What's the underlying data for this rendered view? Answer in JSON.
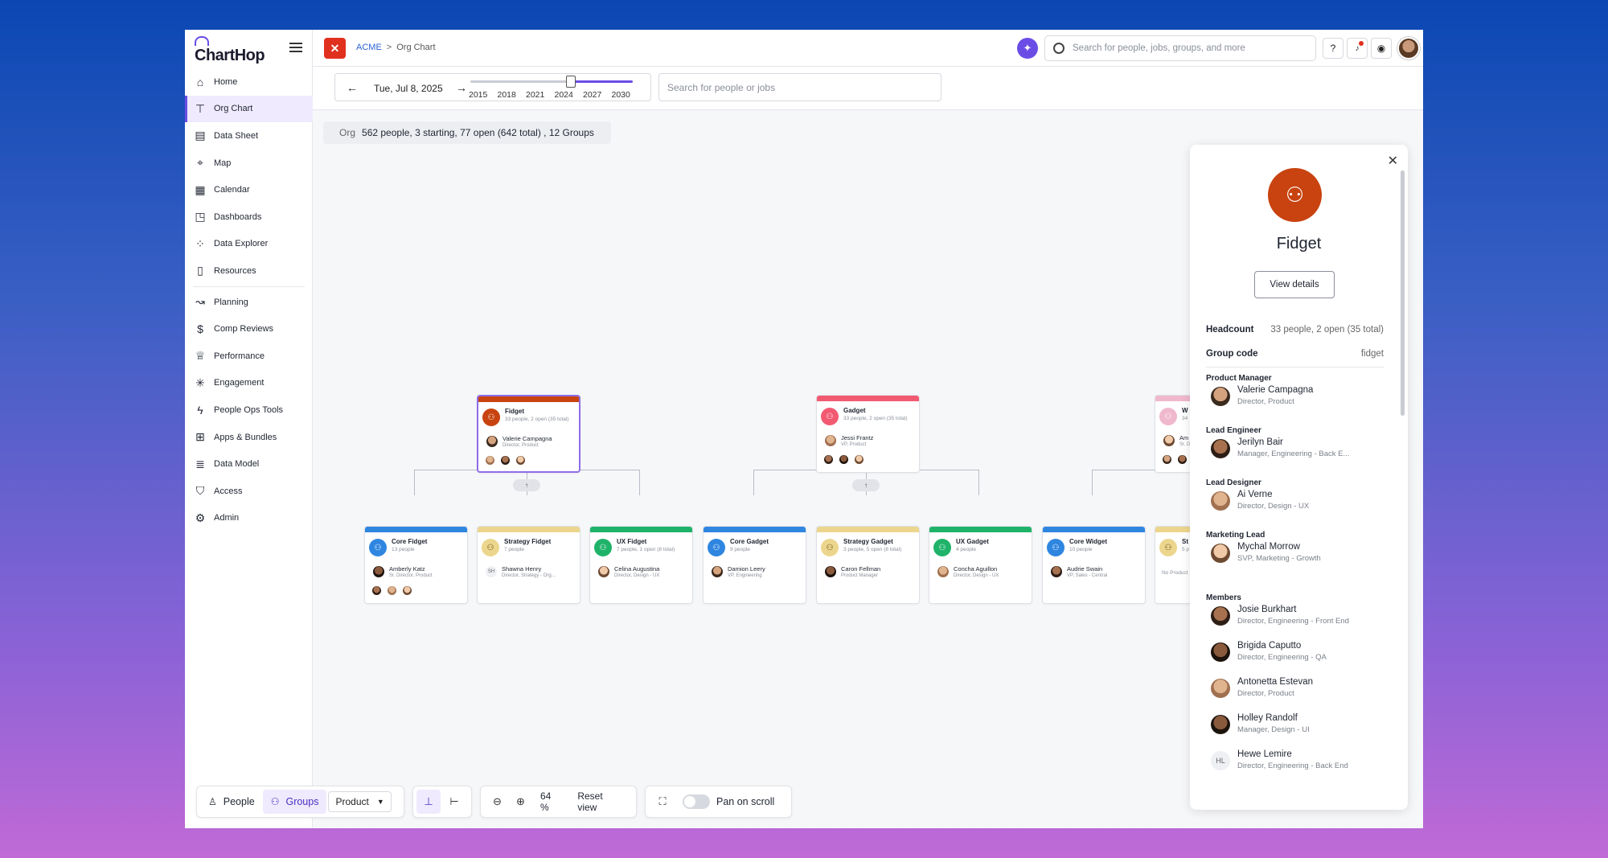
{
  "app": {
    "logo": "ChartHop"
  },
  "sidebar": {
    "items": [
      {
        "label": "Home",
        "icon": "home-icon",
        "glyph": "⌂"
      },
      {
        "label": "Org Chart",
        "icon": "org-chart-icon",
        "glyph": "⊤"
      },
      {
        "label": "Data Sheet",
        "icon": "data-sheet-icon",
        "glyph": "▤"
      },
      {
        "label": "Map",
        "icon": "map-pin-icon",
        "glyph": "⌖"
      },
      {
        "label": "Calendar",
        "icon": "calendar-icon",
        "glyph": "▦"
      },
      {
        "label": "Dashboards",
        "icon": "dashboard-icon",
        "glyph": "◳"
      },
      {
        "label": "Data Explorer",
        "icon": "data-explorer-icon",
        "glyph": "⁘"
      },
      {
        "label": "Resources",
        "icon": "book-icon",
        "glyph": "▯"
      },
      {
        "label": "Planning",
        "icon": "planning-icon",
        "glyph": "↝"
      },
      {
        "label": "Comp Reviews",
        "icon": "dollar-icon",
        "glyph": "$"
      },
      {
        "label": "Performance",
        "icon": "trophy-icon",
        "glyph": "♕"
      },
      {
        "label": "Engagement",
        "icon": "engagement-icon",
        "glyph": "✳"
      },
      {
        "label": "People Ops Tools",
        "icon": "lightning-icon",
        "glyph": "ϟ"
      },
      {
        "label": "Apps & Bundles",
        "icon": "apps-icon",
        "glyph": "⊞"
      },
      {
        "label": "Data Model",
        "icon": "database-icon",
        "glyph": "≣"
      },
      {
        "label": "Access",
        "icon": "shield-icon",
        "glyph": "⛉"
      },
      {
        "label": "Admin",
        "icon": "gear-icon",
        "glyph": "⚙"
      }
    ]
  },
  "topbar": {
    "company_initial": "✕",
    "breadcrumb_company": "ACME",
    "breadcrumb_sep": ">",
    "breadcrumb_page": "Org Chart",
    "search_placeholder": "Search for people, jobs, groups, and more",
    "help": "?",
    "bell": "🔔",
    "eye": "◉"
  },
  "toolbar": {
    "prev": "←",
    "next": "→",
    "date": "Tue, Jul 8, 2025",
    "years": [
      "2015",
      "2018",
      "2021",
      "2024",
      "2027",
      "2030"
    ],
    "slider_value": 0.62,
    "search_placeholder": "Search for people or jobs"
  },
  "summary": {
    "label": "Org",
    "text": "562 people, 3 starting, 77 open (642 total) , 12 Groups"
  },
  "nodes": {
    "fidget": {
      "title": "Fidget",
      "sub": "33 people, 2 open (35 total)",
      "lead": "Valerie Campagna",
      "lead_title": "Director, Product"
    },
    "gadget": {
      "title": "Gadget",
      "sub": "33 people, 2 open (35 total)",
      "lead": "Jessi Frantz",
      "lead_title": "VP, Product"
    },
    "widget": {
      "title": "W",
      "sub": "34",
      "lead": "Am",
      "lead_title": "Sr. D"
    },
    "core_fidget": {
      "title": "Core Fidget",
      "sub": "13 people",
      "lead": "Amberly Katz",
      "lead_title": "Sr. Director, Product"
    },
    "strategy_fidget": {
      "title": "Strategy Fidget",
      "sub": "7 people",
      "lead": "Shawna Henry",
      "lead_title": "Director, Strategy - Org...",
      "initials": "SH"
    },
    "ux_fidget": {
      "title": "UX Fidget",
      "sub": "7 people, 1 open (8 total)",
      "lead": "Celina Augustina",
      "lead_title": "Director, Design - UX"
    },
    "core_gadget": {
      "title": "Core Gadget",
      "sub": "9 people",
      "lead": "Damion Leery",
      "lead_title": "VP, Engineering"
    },
    "strategy_gadget": {
      "title": "Strategy Gadget",
      "sub": "3 people, 5 open (8 total)",
      "lead": "Caron Fellman",
      "lead_title": "Product Manager"
    },
    "ux_gadget": {
      "title": "UX Gadget",
      "sub": "4 people",
      "lead": "Concha Aguillon",
      "lead_title": "Director, Design - UX"
    },
    "core_widget": {
      "title": "Core Widget",
      "sub": "10 people",
      "lead": "Audrie Swain",
      "lead_title": "VP, Sales - Central"
    },
    "strategy_widget": {
      "title": "St",
      "sub": "5 p",
      "muted": "No Product"
    }
  },
  "expand": "↑",
  "bottom": {
    "people": "People",
    "groups": "Groups",
    "filter": "Product",
    "caret": "▼",
    "zoom": "64 %",
    "reset": "Reset view",
    "pan": "Pan on scroll"
  },
  "panel": {
    "close": "✕",
    "title": "Fidget",
    "view_details": "View details",
    "headcount_label": "Headcount",
    "headcount_value": "33 people, 2 open (35 total)",
    "group_code_label": "Group code",
    "group_code_value": "fidget",
    "roles": [
      {
        "role": "Product Manager",
        "name": "Valerie Campagna",
        "title": "Director, Product"
      },
      {
        "role": "Lead Engineer",
        "name": "Jerilyn Bair",
        "title": "Manager, Engineering - Back E..."
      },
      {
        "role": "Lead Designer",
        "name": "Ai Verne",
        "title": "Director, Design - UX"
      },
      {
        "role": "Marketing Lead",
        "name": "Mychal Morrow",
        "title": "SVP, Marketing - Growth"
      }
    ],
    "members_label": "Members",
    "members": [
      {
        "name": "Josie Burkhart",
        "title": "Director, Engineering - Front End"
      },
      {
        "name": "Brigida Caputto",
        "title": "Director, Engineering - QA"
      },
      {
        "name": "Antonetta Estevan",
        "title": "Director, Product"
      },
      {
        "name": "Holley Randolf",
        "title": "Manager, Design - UI"
      },
      {
        "name": "Hewe Lemire",
        "title": "Director, Engineering - Back End",
        "initials": "HL"
      }
    ]
  },
  "colors": {
    "accent": "#6b4de6",
    "fidget": "#c8430f",
    "gadget": "#f25a72",
    "widget": "#f0b8cc",
    "core": "#2f86e0",
    "strategy": "#ecd68e",
    "ux": "#1fb36a"
  }
}
